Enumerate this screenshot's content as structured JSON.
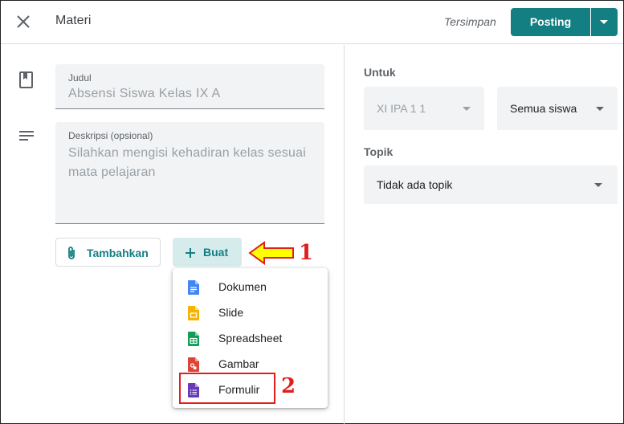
{
  "header": {
    "title": "Materi",
    "saved_status": "Tersimpan",
    "post_label": "Posting"
  },
  "form": {
    "title_label": "Judul",
    "title_value": "Absensi Siswa Kelas IX A",
    "description_label": "Deskripsi (opsional)",
    "description_value": "Silahkan mengisi kehadiran kelas sesuai mata pelajaran",
    "add_label": "Tambahkan",
    "create_label": "Buat"
  },
  "create_menu": {
    "items": [
      {
        "label": "Dokumen",
        "icon": "docs-icon",
        "color": "#4285f4"
      },
      {
        "label": "Slide",
        "icon": "slides-icon",
        "color": "#f4b400"
      },
      {
        "label": "Spreadsheet",
        "icon": "sheets-icon",
        "color": "#0f9d58"
      },
      {
        "label": "Gambar",
        "icon": "drawings-icon",
        "color": "#db4437"
      },
      {
        "label": "Formulir",
        "icon": "forms-icon",
        "color": "#673ab7"
      }
    ]
  },
  "annotations": {
    "step1": "1",
    "step2": "2"
  },
  "side": {
    "for_label": "Untuk",
    "class_value": "XI IPA 1 1",
    "students_value": "Semua siswa",
    "topic_label": "Topik",
    "topic_value": "Tidak ada topik"
  },
  "colors": {
    "accent": "#137f83",
    "annotation": "#e01e1e",
    "arrow_fill": "#ffff00"
  }
}
